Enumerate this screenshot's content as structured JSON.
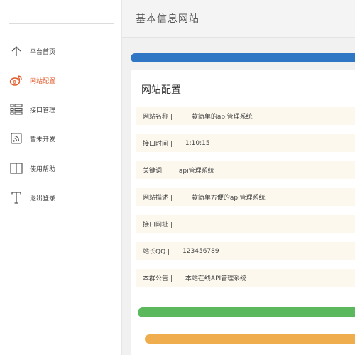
{
  "header": {
    "title": "基本信息网站"
  },
  "sidebar": {
    "items": [
      {
        "label": "平台首页",
        "icon": "arrow-up-icon"
      },
      {
        "label": "网站配置",
        "icon": "weibo-icon"
      },
      {
        "label": "接口管理",
        "icon": "list-icon"
      },
      {
        "label": "暂未开发",
        "icon": "rss-icon"
      },
      {
        "label": "使用帮助",
        "icon": "columns-icon"
      },
      {
        "label": "退出登录",
        "icon": "text-icon"
      }
    ]
  },
  "panel": {
    "title": "网站配置",
    "rows": [
      {
        "label": "网站名称 |",
        "value": "一款简单的api管理系统"
      },
      {
        "label": "接口时间 |",
        "value": "1:10:15"
      },
      {
        "label": "关键词 |",
        "value": "api管理系统"
      },
      {
        "label": "网站描述 |",
        "value": "一款简单方便的api管理系统"
      },
      {
        "label": "接口网址 |",
        "value": ""
      },
      {
        "label": "站长QQ |",
        "value": "123456789"
      },
      {
        "label": "本群公告 |",
        "value": "本站在线API管理系统"
      }
    ]
  },
  "colors": {
    "accent": "#e0592a",
    "progress_blue": "#2f77c5",
    "progress_green": "#5cb85c",
    "progress_orange": "#f0ad4e",
    "row_bg": "#fcf8ee"
  }
}
